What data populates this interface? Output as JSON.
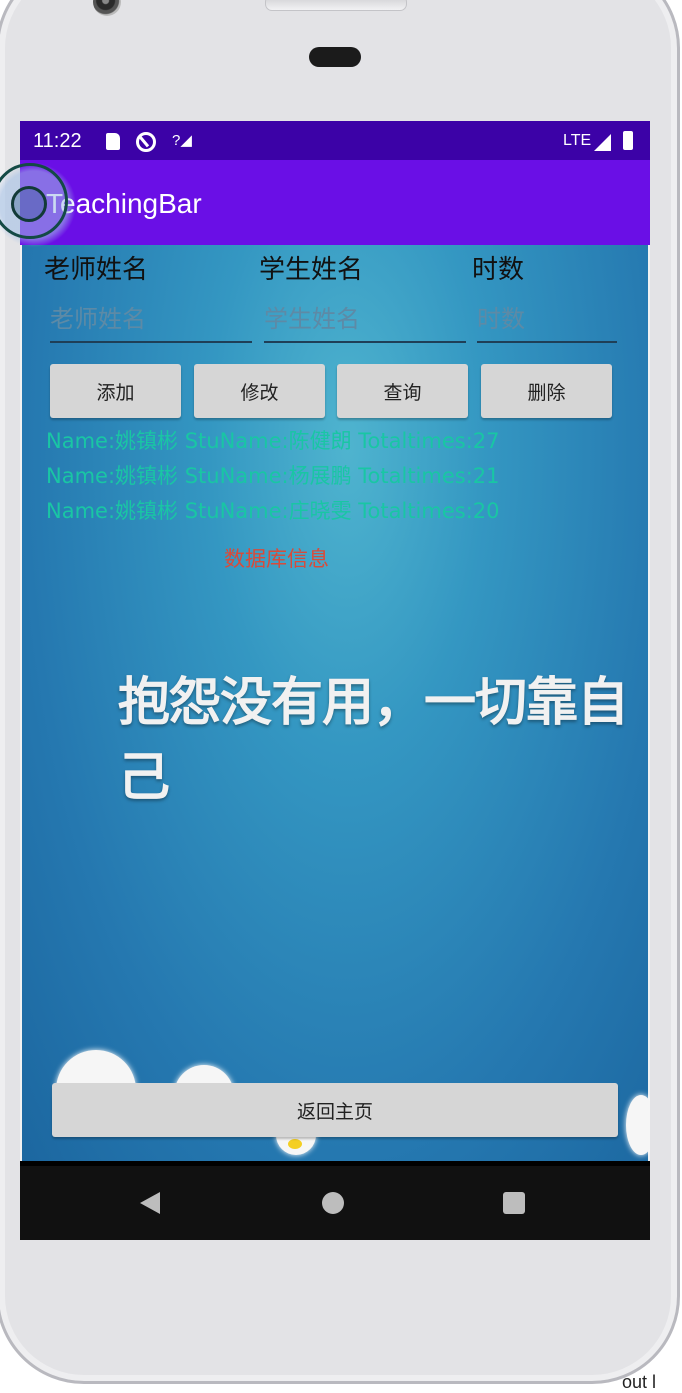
{
  "status_bar": {
    "time": "11:22",
    "network": "LTE",
    "icons": [
      "sd-card-icon",
      "sync-icon",
      "no-signal-icon",
      "lte-signal-icon",
      "battery-icon"
    ]
  },
  "app_bar": {
    "title": "TeachingBar"
  },
  "form": {
    "labels": {
      "teacher": "老师姓名",
      "student": "学生姓名",
      "hours": "时数"
    },
    "placeholders": {
      "teacher": "老师姓名",
      "student": "学生姓名",
      "hours": "时数"
    },
    "values": {
      "teacher": "",
      "student": "",
      "hours": ""
    }
  },
  "buttons": {
    "add": "添加",
    "modify": "修改",
    "query": "查询",
    "delete": "删除",
    "home": "返回主页"
  },
  "records": [
    "Name:姚镇彬 StuName:陈健朗 Totaltimes:27",
    "Name:姚镇彬 StuName:杨展鹏 Totaltimes:21",
    "Name:姚镇彬 StuName:庄晓雯 Totaltimes:20"
  ],
  "db_info": "数据库信息",
  "slogan": "抱怨没有用，一切靠自己",
  "stray_text": "out l",
  "colors": {
    "status_bar": "#3c02a7",
    "app_bar": "#6a0fe6",
    "record_text": "#19c6a4",
    "db_info_text": "#d94b3a"
  }
}
